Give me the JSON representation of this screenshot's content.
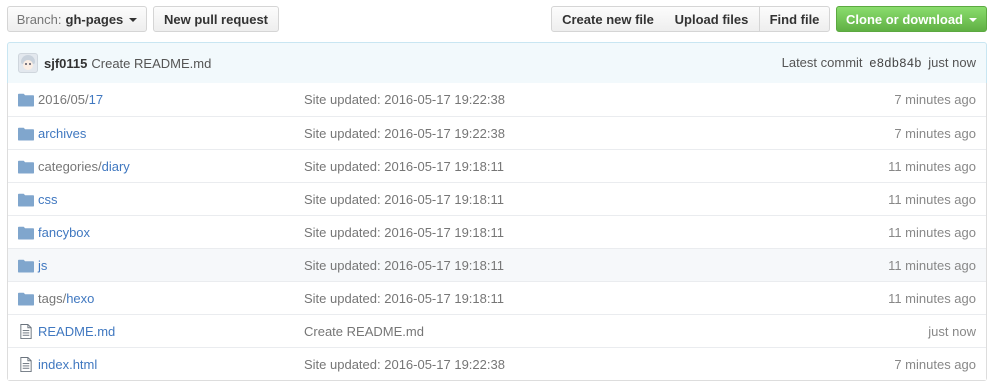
{
  "toolbar": {
    "branch_label": "Branch:",
    "branch_value": "gh-pages",
    "new_pr": "New pull request",
    "create_file": "Create new file",
    "upload_files": "Upload files",
    "find_file": "Find file",
    "clone_download": "Clone or download"
  },
  "colors": {
    "link": "#4078c0",
    "commit_bar_bg": "#f2f9fc",
    "clone_green": "#60b044",
    "folder_icon": "#80a6cd"
  },
  "commit": {
    "author": "sjf0115",
    "message": "Create README.md",
    "latest_label": "Latest commit",
    "sha": "e8db84b",
    "time": "just now"
  },
  "files": [
    {
      "icon": "folder-icon",
      "prefix": "2016/05/",
      "name": "17",
      "message": "Site updated: 2016-05-17 19:22:38",
      "age": "7 minutes ago"
    },
    {
      "icon": "folder-icon",
      "prefix": "",
      "name": "archives",
      "message": "Site updated: 2016-05-17 19:22:38",
      "age": "7 minutes ago"
    },
    {
      "icon": "folder-icon",
      "prefix": "categories/",
      "name": "diary",
      "message": "Site updated: 2016-05-17 19:18:11",
      "age": "11 minutes ago"
    },
    {
      "icon": "folder-icon",
      "prefix": "",
      "name": "css",
      "message": "Site updated: 2016-05-17 19:18:11",
      "age": "11 minutes ago"
    },
    {
      "icon": "folder-icon",
      "prefix": "",
      "name": "fancybox",
      "message": "Site updated: 2016-05-17 19:18:11",
      "age": "11 minutes ago"
    },
    {
      "icon": "folder-icon",
      "prefix": "",
      "name": "js",
      "message": "Site updated: 2016-05-17 19:18:11",
      "age": "11 minutes ago",
      "highlighted": true
    },
    {
      "icon": "folder-icon",
      "prefix": "tags/",
      "name": "hexo",
      "message": "Site updated: 2016-05-17 19:18:11",
      "age": "11 minutes ago"
    },
    {
      "icon": "file-icon",
      "prefix": "",
      "name": "README.md",
      "message": "Create README.md",
      "age": "just now"
    },
    {
      "icon": "file-icon",
      "prefix": "",
      "name": "index.html",
      "message": "Site updated: 2016-05-17 19:22:38",
      "age": "7 minutes ago"
    }
  ]
}
